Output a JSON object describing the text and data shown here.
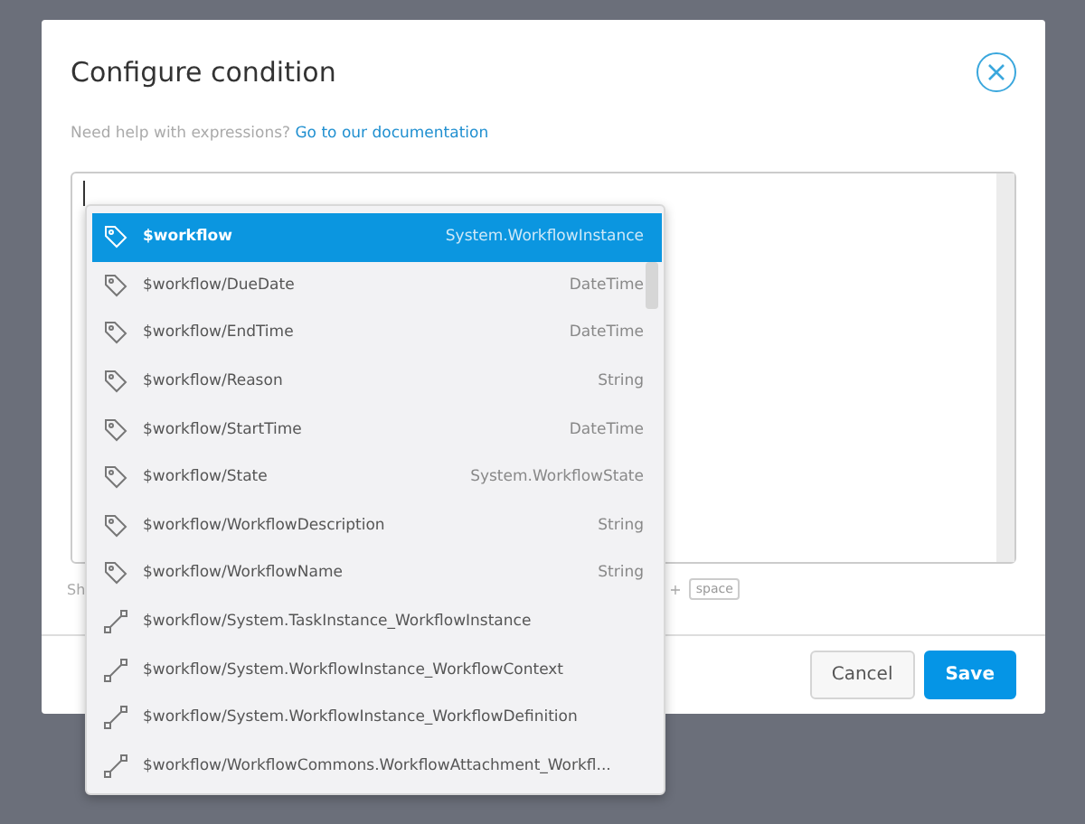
{
  "dialog": {
    "title": "Configure condition",
    "help_text": "Need help with expressions?",
    "help_link": "Go to our documentation"
  },
  "editor": {
    "hint_start": "Sh",
    "hint_plus": "+",
    "hint_key": "space"
  },
  "suggestions": [
    {
      "kind": "property",
      "name": "$workflow",
      "type": "System.WorkflowInstance",
      "selected": true
    },
    {
      "kind": "property",
      "name": "$workflow/DueDate",
      "type": "DateTime",
      "selected": false
    },
    {
      "kind": "property",
      "name": "$workflow/EndTime",
      "type": "DateTime",
      "selected": false
    },
    {
      "kind": "property",
      "name": "$workflow/Reason",
      "type": "String",
      "selected": false
    },
    {
      "kind": "property",
      "name": "$workflow/StartTime",
      "type": "DateTime",
      "selected": false
    },
    {
      "kind": "property",
      "name": "$workflow/State",
      "type": "System.WorkflowState",
      "selected": false
    },
    {
      "kind": "property",
      "name": "$workflow/WorkflowDescription",
      "type": "String",
      "selected": false
    },
    {
      "kind": "property",
      "name": "$workflow/WorkflowName",
      "type": "String",
      "selected": false
    },
    {
      "kind": "relation",
      "name": "$workflow/System.TaskInstance_WorkflowInstance",
      "selected": false
    },
    {
      "kind": "relation",
      "name": "$workflow/System.WorkflowInstance_WorkflowContext",
      "selected": false
    },
    {
      "kind": "relation",
      "name": "$workflow/System.WorkflowInstance_WorkflowDefinition",
      "selected": false
    },
    {
      "kind": "relation",
      "name": "$workflow/WorkflowCommons.WorkflowAttachment_Workfl...",
      "selected": false
    }
  ],
  "buttons": [
    {
      "kind": "secondary",
      "label": "Cancel"
    },
    {
      "kind": "primary",
      "label": "Save"
    }
  ]
}
